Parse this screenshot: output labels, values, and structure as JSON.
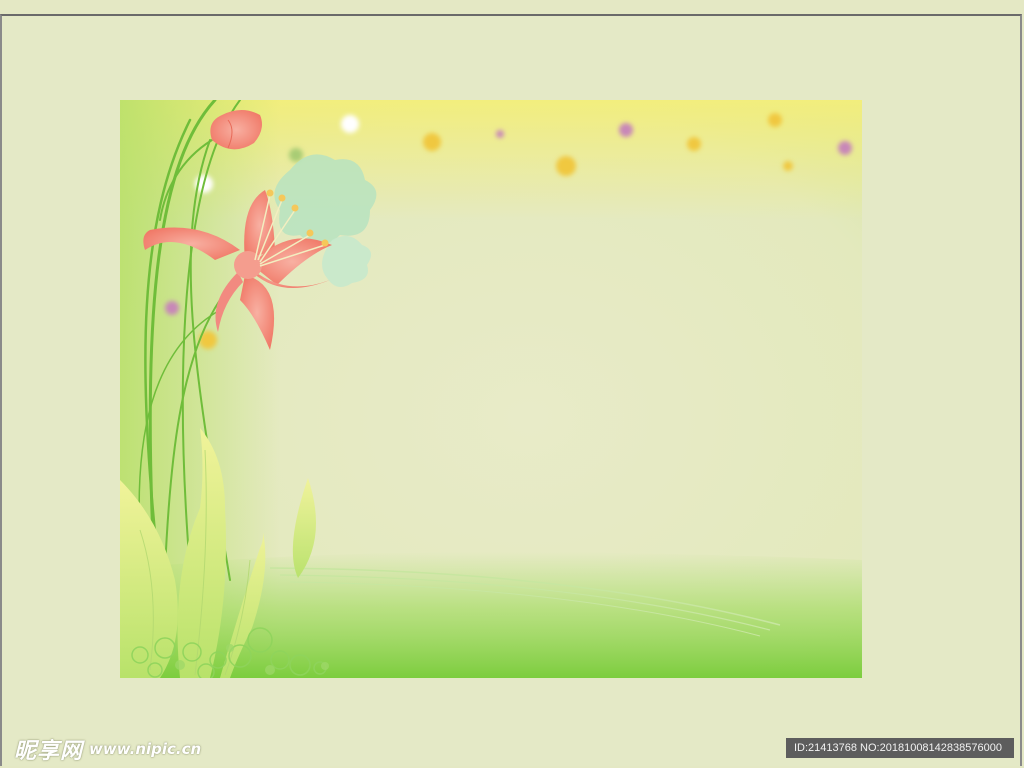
{
  "image": {
    "background_color": "#e4e9c6",
    "artwork": {
      "subject": "floral-greeting-card-background",
      "colors": {
        "lily": "#f28a80",
        "foliage": "#8fd45c",
        "sky_yellow": "#f2ec8a",
        "card_center": "#e8ebc6"
      }
    }
  },
  "watermark": {
    "logo_text": "昵享网",
    "url_text": "www.nipic.cn"
  },
  "id_badge": {
    "text": "ID:21413768 NO:20181008142838576000"
  }
}
